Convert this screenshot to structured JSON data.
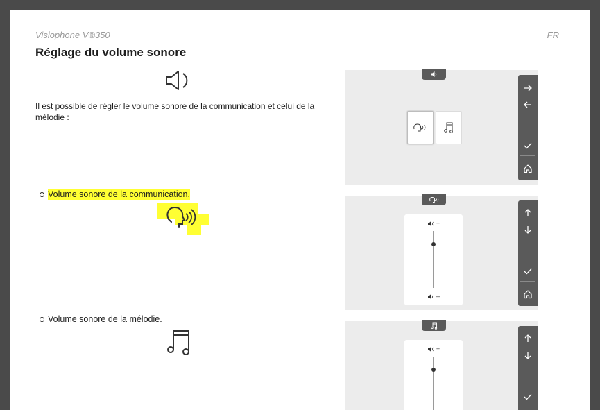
{
  "header": {
    "doc_title": "Visiophone V®350",
    "lang": "FR",
    "heading": "Réglage du volume sonore"
  },
  "intro": "Il est possible de régler le volume sonore de la communication et celui de la mélodie :",
  "bullets": [
    {
      "label": "Volume sonore de la communication.",
      "highlighted": true
    },
    {
      "label": "Volume sonore de la mélodie.",
      "highlighted": false
    }
  ],
  "volume_panel": {
    "plus_label": "+",
    "minus_label": "–"
  },
  "colors": {
    "highlight": "#ffff33",
    "screen_bg": "#ececec",
    "sidebar": "#5a5a5a",
    "page_bg": "#4a4a4a"
  }
}
